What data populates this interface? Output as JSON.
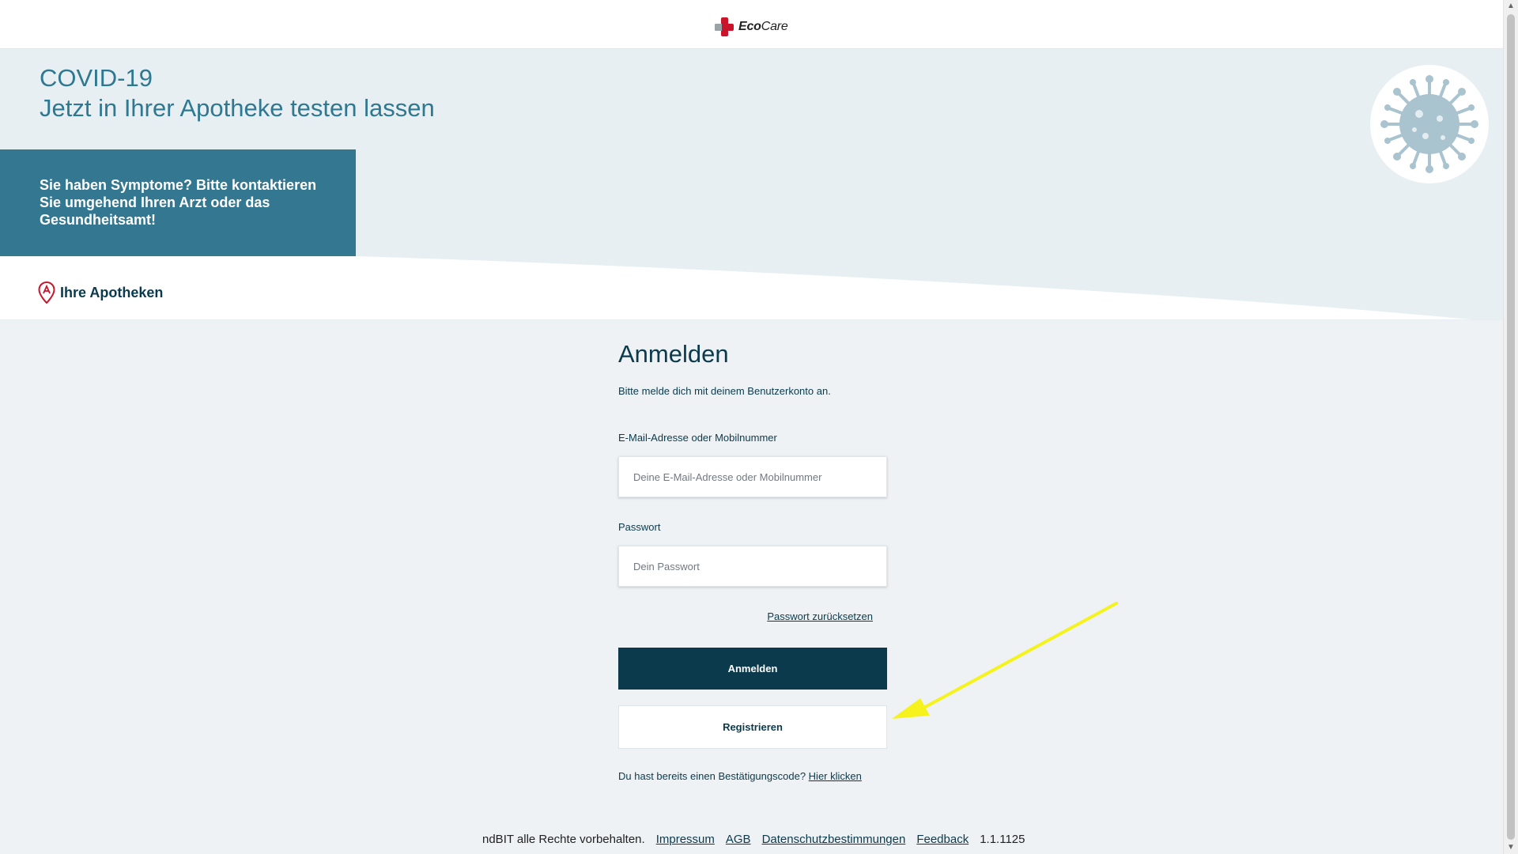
{
  "brand": {
    "name_bold": "Eco",
    "name_rest": "Care"
  },
  "hero": {
    "title_line1": "COVID-19",
    "title_line2": "Jetzt in Ihrer Apotheke testen lassen",
    "symptom_text": "Sie haben Symptome? Bitte kontaktieren Sie umgehend Ihren Arzt oder das Gesundheitsamt!"
  },
  "apotheken": {
    "label": "Ihre Apotheken"
  },
  "login": {
    "title": "Anmelden",
    "intro": "Bitte melde dich mit deinem Benutzerkonto an.",
    "email_label": "E-Mail-Adresse oder Mobilnummer",
    "email_placeholder": "Deine E-Mail-Adresse oder Mobilnummer",
    "email_value": "",
    "password_label": "Passwort",
    "password_placeholder": "Dein Passwort",
    "password_value": "",
    "reset_link": "Passwort zurücksetzen",
    "login_button": "Anmelden",
    "register_button": "Registrieren",
    "code_text": "Du hast bereits einen Bestätigungscode?",
    "code_link": "Hier klicken"
  },
  "footer": {
    "copyright": "ndBIT alle Rechte vorbehalten.",
    "impressum": "Impressum",
    "agb": "AGB",
    "datenschutz": "Datenschutzbestimmungen",
    "feedback": "Feedback",
    "version": "1.1.1125"
  },
  "colors": {
    "primary": "#0b3a4c",
    "accent": "#2e7891",
    "symptom_box": "#337790",
    "brand_red": "#c9142b",
    "annotation_arrow": "#f5f21c"
  },
  "icons": [
    "ecocare-cross-icon",
    "virus-icon",
    "location-pin-icon",
    "annotation-arrow-icon",
    "scroll-up-icon",
    "scroll-down-icon"
  ]
}
